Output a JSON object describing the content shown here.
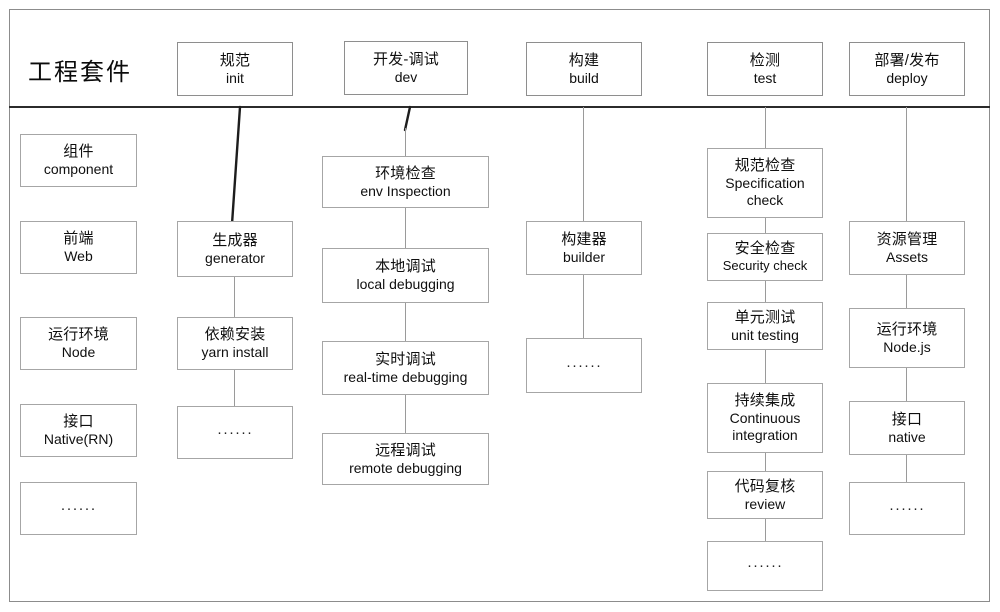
{
  "diagram": {
    "title_cn": "工程套件",
    "header_row": [
      {
        "cn": "规范",
        "en": "init"
      },
      {
        "cn": "开发-调试",
        "en": "dev"
      },
      {
        "cn": "构建",
        "en": "build"
      },
      {
        "cn": "检测",
        "en": "test"
      },
      {
        "cn": "部署/发布",
        "en": "deploy"
      }
    ],
    "columns": [
      {
        "key": "suite",
        "nodes": [
          {
            "cn": "组件",
            "en": "component"
          },
          {
            "cn": "前端",
            "en": "Web"
          },
          {
            "cn": "运行环境",
            "en": "Node"
          },
          {
            "cn": "接口",
            "en": "Native(RN)"
          },
          {
            "cn": "",
            "en": "",
            "dots": "······"
          }
        ]
      },
      {
        "key": "init",
        "nodes": [
          {
            "cn": "生成器",
            "en": "generator"
          },
          {
            "cn": "依赖安装",
            "en": "yarn install"
          },
          {
            "cn": "",
            "en": "",
            "dots": "······"
          }
        ]
      },
      {
        "key": "dev",
        "nodes": [
          {
            "cn": "环境检查",
            "en": "env Inspection"
          },
          {
            "cn": "本地调试",
            "en": "local debugging"
          },
          {
            "cn": "实时调试",
            "en": "real-time debugging"
          },
          {
            "cn": "远程调试",
            "en": "remote debugging"
          }
        ]
      },
      {
        "key": "build",
        "nodes": [
          {
            "cn": "构建器",
            "en": "builder"
          },
          {
            "cn": "",
            "en": "",
            "dots": "······"
          }
        ]
      },
      {
        "key": "test",
        "nodes": [
          {
            "cn": "规范检查",
            "en": "Specification check"
          },
          {
            "cn": "安全检查",
            "en": "Security check"
          },
          {
            "cn": "单元测试",
            "en": "unit testing"
          },
          {
            "cn": "持续集成",
            "en": "Continuous integration"
          },
          {
            "cn": "代码复核",
            "en": "review"
          },
          {
            "cn": "",
            "en": "",
            "dots": "······"
          }
        ]
      },
      {
        "key": "deploy",
        "nodes": [
          {
            "cn": "资源管理",
            "en": "Assets"
          },
          {
            "cn": "运行环境",
            "en": "Node.js"
          },
          {
            "cn": "接口",
            "en": "native"
          },
          {
            "cn": "",
            "en": "",
            "dots": "······"
          }
        ]
      }
    ],
    "colors": {
      "frame_border": "#8c8c8c",
      "box_border": "#a6a6a6",
      "connector": "#9a9a9a",
      "connector_dark": "#1d1d1d",
      "text": "#0f0f0f",
      "background": "#ffffff"
    }
  }
}
